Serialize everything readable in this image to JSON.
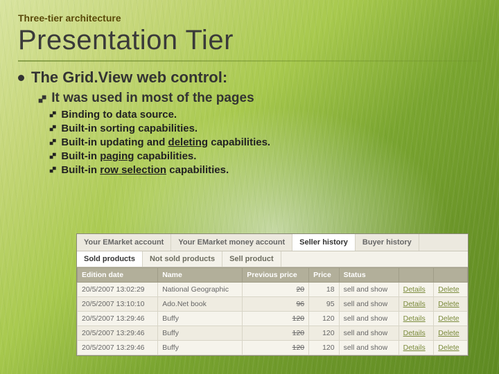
{
  "header": {
    "topic": "Three-tier architecture",
    "title": "Presentation Tier"
  },
  "bullets": {
    "l1": "The Grid.View web control:",
    "l2": "It was used in most of the pages",
    "items": [
      {
        "pre": "",
        "u": "",
        "post": "Binding to data source."
      },
      {
        "pre": "",
        "u": "",
        "post": "Built-in sorting capabilities."
      },
      {
        "pre": "Built-in updating and ",
        "u": "deleting",
        "post": " capabilities."
      },
      {
        "pre": "Built-in ",
        "u": "paging",
        "post": " capabilities."
      },
      {
        "pre": "Built-in ",
        "u": "row selection",
        "post": " capabilities."
      }
    ]
  },
  "grid": {
    "tabs": [
      "Your EMarket account",
      "Your EMarket money account",
      "Seller history",
      "Buyer history"
    ],
    "active_tab": 2,
    "subtabs": [
      "Sold products",
      "Not sold products",
      "Sell product"
    ],
    "active_subtab": 0,
    "columns": [
      "Edition date",
      "Name",
      "Previous price",
      "Price",
      "Status",
      "",
      ""
    ],
    "action_details": "Details",
    "action_delete": "Delete",
    "rows": [
      {
        "date": "20/5/2007 13:02:29",
        "name": "National Geographic",
        "prev": "20",
        "price": "18",
        "status": "sell and show"
      },
      {
        "date": "20/5/2007 13:10:10",
        "name": "Ado.Net book",
        "prev": "96",
        "price": "95",
        "status": "sell and show"
      },
      {
        "date": "20/5/2007 13:29:46",
        "name": "Buffy",
        "prev": "120",
        "price": "120",
        "status": "sell and show"
      },
      {
        "date": "20/5/2007 13:29:46",
        "name": "Buffy",
        "prev": "120",
        "price": "120",
        "status": "sell and show"
      },
      {
        "date": "20/5/2007 13:29:46",
        "name": "Buffy",
        "prev": "120",
        "price": "120",
        "status": "sell and show"
      }
    ]
  }
}
